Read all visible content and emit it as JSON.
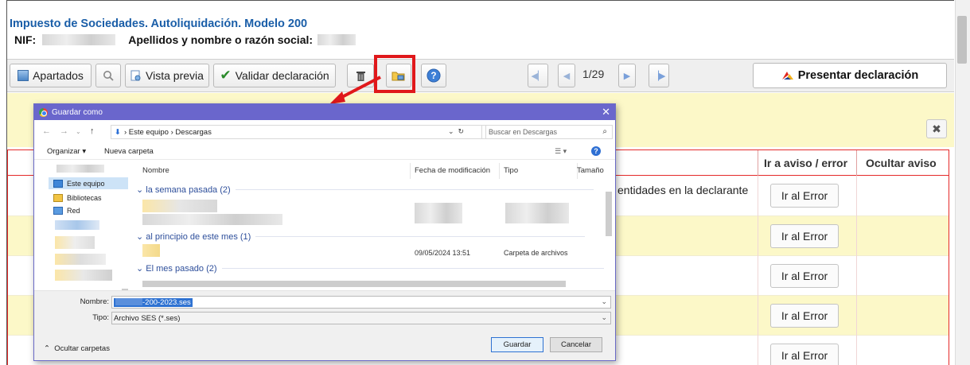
{
  "app": {
    "title": "Impuesto de Sociedades. Autoliquidación. Modelo 200",
    "nif_label": "NIF:",
    "name_label": "Apellidos y nombre o razón social:"
  },
  "toolbar": {
    "apartados": "Apartados",
    "vista_previa": "Vista previa",
    "validar": "Validar declaración",
    "page_indicator": "1/29",
    "presentar": "Presentar declaración"
  },
  "table": {
    "col_aviso": "Ir a aviso / error",
    "col_ocultar": "Ocultar aviso",
    "row_text": "entidades en la declarante",
    "button_label": "Ir al Error",
    "rows": [
      "Ir al Error",
      "Ir al Error",
      "Ir al Error",
      "Ir al Error",
      "Ir al Error"
    ]
  },
  "dialog": {
    "title": "Guardar como",
    "breadcrumb_1": "Este equipo",
    "breadcrumb_2": "Descargas",
    "search_placeholder": "Buscar en Descargas",
    "organize": "Organizar ▾",
    "new_folder": "Nueva carpeta",
    "nav_items": [
      "Este equipo",
      "Bibliotecas",
      "Red"
    ],
    "columns": {
      "name": "Nombre",
      "date": "Fecha de modificación",
      "type": "Tipo",
      "size": "Tamaño"
    },
    "groups": [
      "la semana pasada (2)",
      "al principio de este mes (1)",
      "El mes pasado (2)"
    ],
    "file_date": "09/05/2024 13:51",
    "file_type": "Carpeta de archivos",
    "name_label": "Nombre:",
    "filename": "-200-2023.ses",
    "type_label": "Tipo:",
    "filetype": "Archivo SES (*.ses)",
    "hide_folders": "Ocultar carpetas",
    "save": "Guardar",
    "cancel": "Cancelar"
  },
  "colors": {
    "title_blue": "#1a5ea8",
    "dialog_titlebar": "#6a66cc",
    "highlight_red": "#e0181b",
    "notice_yellow": "#fcf8c8"
  }
}
